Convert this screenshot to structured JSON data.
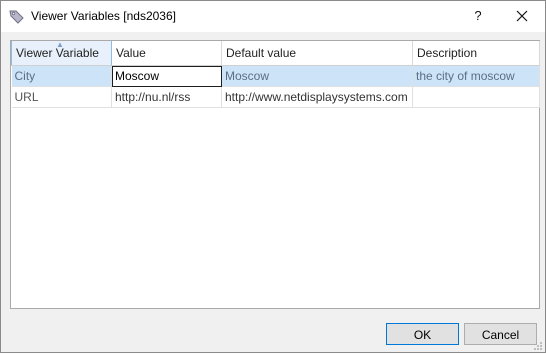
{
  "window": {
    "title": "Viewer Variables [nds2036]",
    "help_label": "?",
    "close_icon": "close-icon"
  },
  "grid": {
    "columns": [
      {
        "label": "Viewer Variable",
        "sorted": true
      },
      {
        "label": "Value"
      },
      {
        "label": "Default value"
      },
      {
        "label": "Description"
      }
    ],
    "rows": [
      {
        "name": "City",
        "value": "Moscow",
        "default": "Moscow",
        "description": "the city of moscow",
        "selected": true
      },
      {
        "name": "URL",
        "value": "http://nu.nl/rss",
        "default": "http://www.netdisplaysystems.com",
        "description": ""
      }
    ]
  },
  "buttons": {
    "ok": "OK",
    "cancel": "Cancel"
  },
  "colors": {
    "selection": "#cde3f8",
    "accent": "#0078d7"
  }
}
